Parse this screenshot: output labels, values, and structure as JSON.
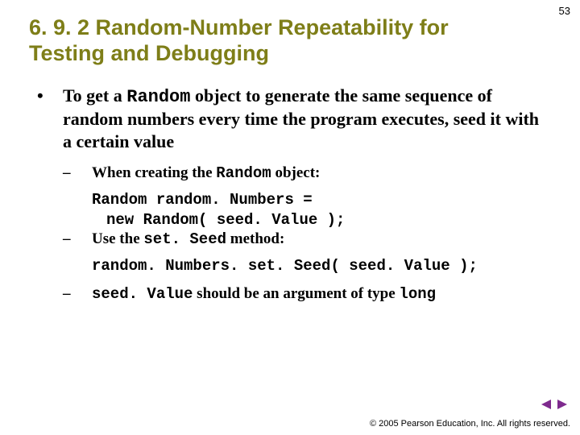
{
  "page_number": "53",
  "title": "6. 9. 2 Random-Number Repeatability for Testing and Debugging",
  "bullet_main": {
    "pre": "To get a ",
    "code": "Random",
    "post": " object to generate the same sequence of random numbers every time the program executes, seed it with a certain value"
  },
  "sub1": {
    "pre": "When creating the ",
    "code": "Random",
    "post": " object:"
  },
  "code1_line1": "Random random. Numbers =",
  "code1_line2": "new Random( seed. Value );",
  "sub2": {
    "pre": "Use the ",
    "code": "set. Seed",
    "post": " method:"
  },
  "code2_line1": "random. Numbers. set. Seed( seed. Value );",
  "sub3": {
    "code1": "seed. Value",
    "mid": " should be an argument of type ",
    "code2": "long"
  },
  "footer": "© 2005 Pearson Education, Inc.  All rights reserved."
}
